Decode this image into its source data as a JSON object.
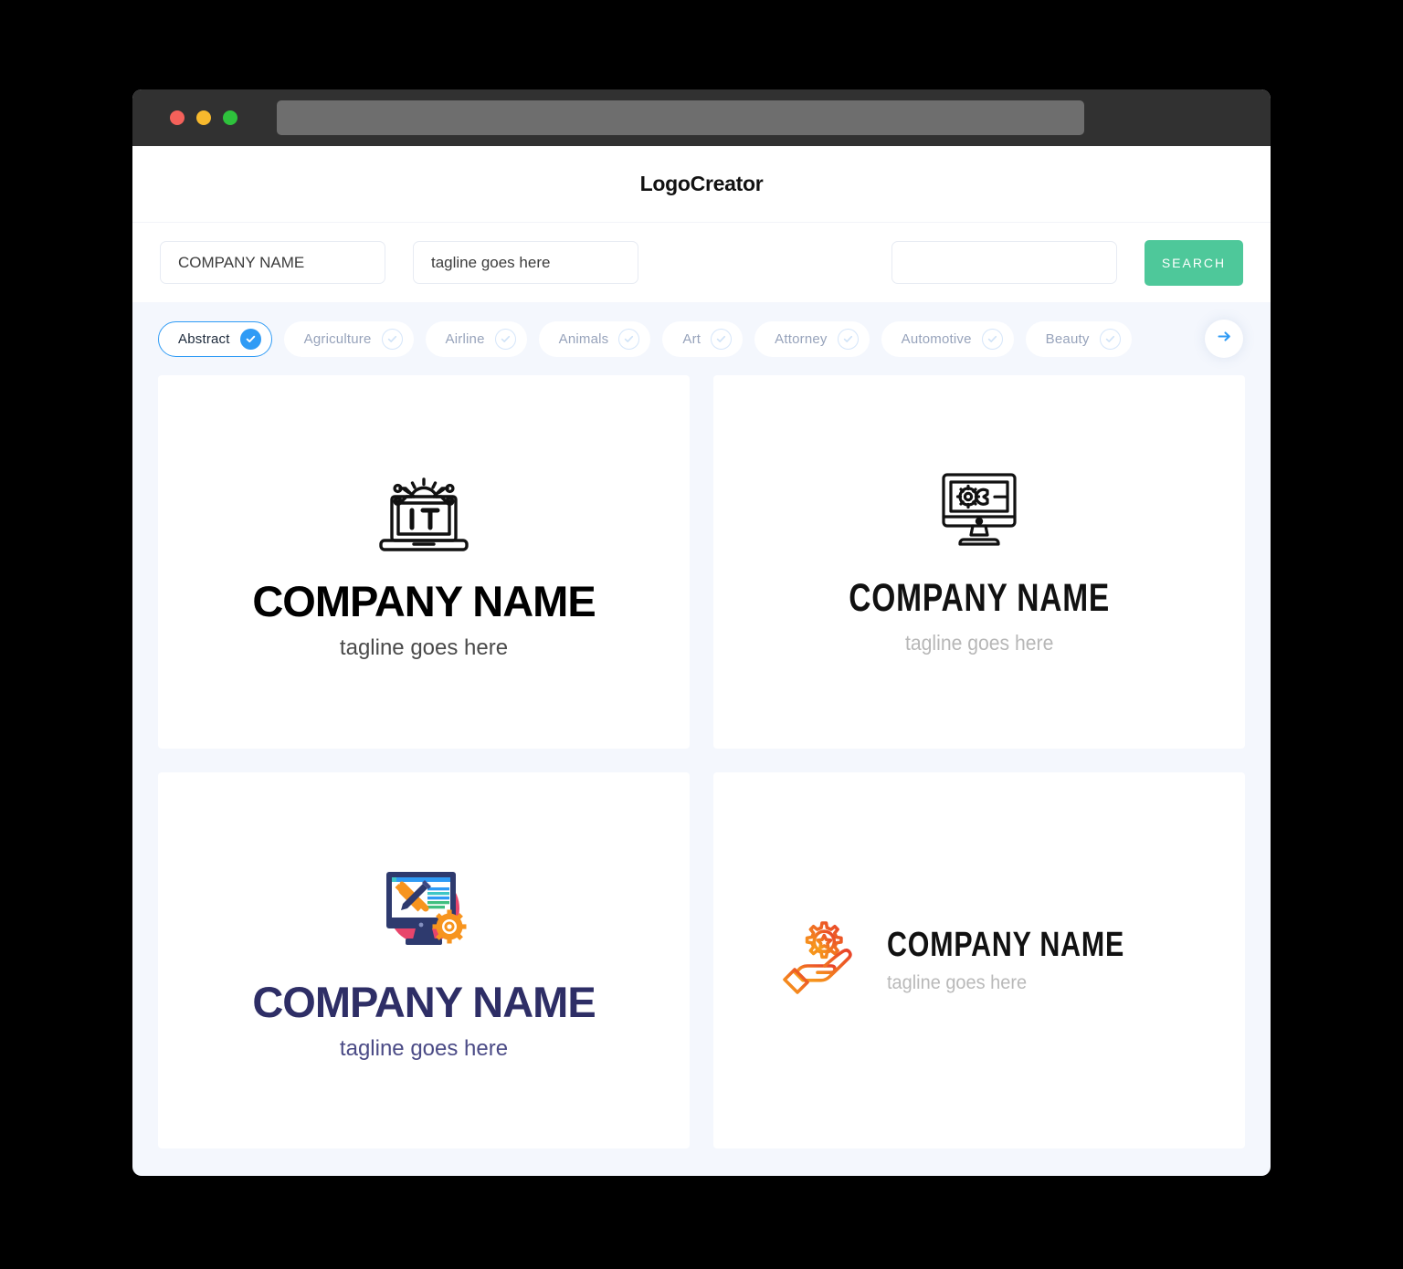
{
  "window": {
    "traffic_lights": [
      {
        "name": "close",
        "color": "#f4615a"
      },
      {
        "name": "minimize",
        "color": "#f7b92d"
      },
      {
        "name": "maximize",
        "color": "#2ec23c"
      }
    ],
    "url_value": ""
  },
  "header": {
    "title": "LogoCreator"
  },
  "search": {
    "company_value": "COMPANY NAME",
    "company_placeholder": "COMPANY NAME",
    "tagline_value": "tagline goes here",
    "tagline_placeholder": "tagline goes here",
    "keyword_value": "",
    "keyword_placeholder": "",
    "button_label": "SEARCH",
    "button_color": "#4ec89a"
  },
  "categories": {
    "accent_color": "#2f9bf5",
    "next_label": "→",
    "items": [
      {
        "label": "Abstract",
        "selected": true
      },
      {
        "label": "Agriculture",
        "selected": false
      },
      {
        "label": "Airline",
        "selected": false
      },
      {
        "label": "Animals",
        "selected": false
      },
      {
        "label": "Art",
        "selected": false
      },
      {
        "label": "Attorney",
        "selected": false
      },
      {
        "label": "Automotive",
        "selected": false
      },
      {
        "label": "Beauty",
        "selected": false
      }
    ]
  },
  "logos": [
    {
      "icon": "laptop-it-gear-circuit-icon",
      "name": "COMPANY NAME",
      "tagline": "tagline goes here",
      "name_color": "#000000",
      "tagline_color": "#4a4a4a"
    },
    {
      "icon": "monitor-gear-wrench-icon",
      "name": "COMPANY NAME",
      "tagline": "tagline goes here",
      "name_color": "#111111",
      "tagline_color": "#b7b7b7"
    },
    {
      "icon": "monitor-tools-gear-color-icon",
      "name": "COMPANY NAME",
      "tagline": "tagline goes here",
      "name_color": "#2e2e66",
      "tagline_color": "#4b4b86"
    },
    {
      "icon": "hand-gear-star-icon",
      "name": "COMPANY NAME",
      "tagline": "tagline goes here",
      "name_color": "#111111",
      "tagline_color": "#b9b9b9"
    }
  ]
}
